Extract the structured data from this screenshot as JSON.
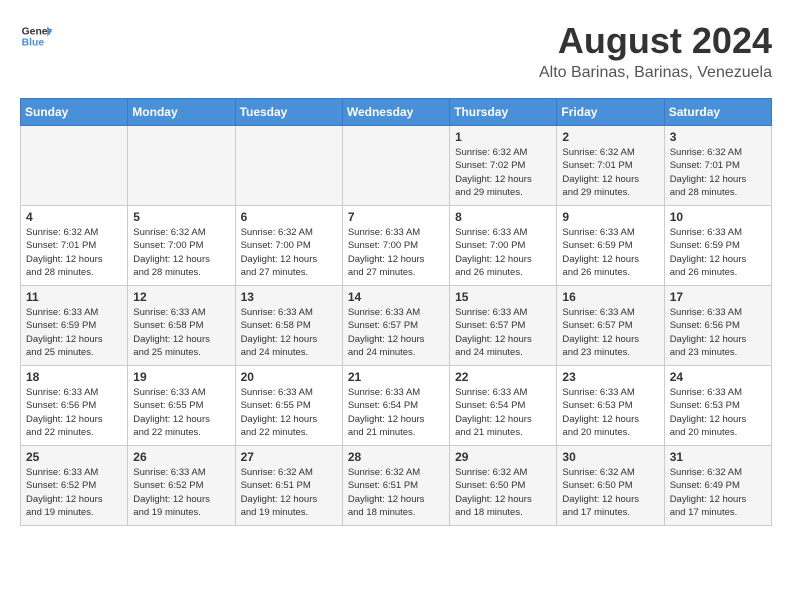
{
  "header": {
    "logo_line1": "General",
    "logo_line2": "Blue",
    "month_year": "August 2024",
    "location": "Alto Barinas, Barinas, Venezuela"
  },
  "days_of_week": [
    "Sunday",
    "Monday",
    "Tuesday",
    "Wednesday",
    "Thursday",
    "Friday",
    "Saturday"
  ],
  "weeks": [
    [
      {
        "day": "",
        "info": ""
      },
      {
        "day": "",
        "info": ""
      },
      {
        "day": "",
        "info": ""
      },
      {
        "day": "",
        "info": ""
      },
      {
        "day": "1",
        "info": "Sunrise: 6:32 AM\nSunset: 7:02 PM\nDaylight: 12 hours\nand 29 minutes."
      },
      {
        "day": "2",
        "info": "Sunrise: 6:32 AM\nSunset: 7:01 PM\nDaylight: 12 hours\nand 29 minutes."
      },
      {
        "day": "3",
        "info": "Sunrise: 6:32 AM\nSunset: 7:01 PM\nDaylight: 12 hours\nand 28 minutes."
      }
    ],
    [
      {
        "day": "4",
        "info": "Sunrise: 6:32 AM\nSunset: 7:01 PM\nDaylight: 12 hours\nand 28 minutes."
      },
      {
        "day": "5",
        "info": "Sunrise: 6:32 AM\nSunset: 7:00 PM\nDaylight: 12 hours\nand 28 minutes."
      },
      {
        "day": "6",
        "info": "Sunrise: 6:32 AM\nSunset: 7:00 PM\nDaylight: 12 hours\nand 27 minutes."
      },
      {
        "day": "7",
        "info": "Sunrise: 6:33 AM\nSunset: 7:00 PM\nDaylight: 12 hours\nand 27 minutes."
      },
      {
        "day": "8",
        "info": "Sunrise: 6:33 AM\nSunset: 7:00 PM\nDaylight: 12 hours\nand 26 minutes."
      },
      {
        "day": "9",
        "info": "Sunrise: 6:33 AM\nSunset: 6:59 PM\nDaylight: 12 hours\nand 26 minutes."
      },
      {
        "day": "10",
        "info": "Sunrise: 6:33 AM\nSunset: 6:59 PM\nDaylight: 12 hours\nand 26 minutes."
      }
    ],
    [
      {
        "day": "11",
        "info": "Sunrise: 6:33 AM\nSunset: 6:59 PM\nDaylight: 12 hours\nand 25 minutes."
      },
      {
        "day": "12",
        "info": "Sunrise: 6:33 AM\nSunset: 6:58 PM\nDaylight: 12 hours\nand 25 minutes."
      },
      {
        "day": "13",
        "info": "Sunrise: 6:33 AM\nSunset: 6:58 PM\nDaylight: 12 hours\nand 24 minutes."
      },
      {
        "day": "14",
        "info": "Sunrise: 6:33 AM\nSunset: 6:57 PM\nDaylight: 12 hours\nand 24 minutes."
      },
      {
        "day": "15",
        "info": "Sunrise: 6:33 AM\nSunset: 6:57 PM\nDaylight: 12 hours\nand 24 minutes."
      },
      {
        "day": "16",
        "info": "Sunrise: 6:33 AM\nSunset: 6:57 PM\nDaylight: 12 hours\nand 23 minutes."
      },
      {
        "day": "17",
        "info": "Sunrise: 6:33 AM\nSunset: 6:56 PM\nDaylight: 12 hours\nand 23 minutes."
      }
    ],
    [
      {
        "day": "18",
        "info": "Sunrise: 6:33 AM\nSunset: 6:56 PM\nDaylight: 12 hours\nand 22 minutes."
      },
      {
        "day": "19",
        "info": "Sunrise: 6:33 AM\nSunset: 6:55 PM\nDaylight: 12 hours\nand 22 minutes."
      },
      {
        "day": "20",
        "info": "Sunrise: 6:33 AM\nSunset: 6:55 PM\nDaylight: 12 hours\nand 22 minutes."
      },
      {
        "day": "21",
        "info": "Sunrise: 6:33 AM\nSunset: 6:54 PM\nDaylight: 12 hours\nand 21 minutes."
      },
      {
        "day": "22",
        "info": "Sunrise: 6:33 AM\nSunset: 6:54 PM\nDaylight: 12 hours\nand 21 minutes."
      },
      {
        "day": "23",
        "info": "Sunrise: 6:33 AM\nSunset: 6:53 PM\nDaylight: 12 hours\nand 20 minutes."
      },
      {
        "day": "24",
        "info": "Sunrise: 6:33 AM\nSunset: 6:53 PM\nDaylight: 12 hours\nand 20 minutes."
      }
    ],
    [
      {
        "day": "25",
        "info": "Sunrise: 6:33 AM\nSunset: 6:52 PM\nDaylight: 12 hours\nand 19 minutes."
      },
      {
        "day": "26",
        "info": "Sunrise: 6:33 AM\nSunset: 6:52 PM\nDaylight: 12 hours\nand 19 minutes."
      },
      {
        "day": "27",
        "info": "Sunrise: 6:32 AM\nSunset: 6:51 PM\nDaylight: 12 hours\nand 19 minutes."
      },
      {
        "day": "28",
        "info": "Sunrise: 6:32 AM\nSunset: 6:51 PM\nDaylight: 12 hours\nand 18 minutes."
      },
      {
        "day": "29",
        "info": "Sunrise: 6:32 AM\nSunset: 6:50 PM\nDaylight: 12 hours\nand 18 minutes."
      },
      {
        "day": "30",
        "info": "Sunrise: 6:32 AM\nSunset: 6:50 PM\nDaylight: 12 hours\nand 17 minutes."
      },
      {
        "day": "31",
        "info": "Sunrise: 6:32 AM\nSunset: 6:49 PM\nDaylight: 12 hours\nand 17 minutes."
      }
    ]
  ]
}
